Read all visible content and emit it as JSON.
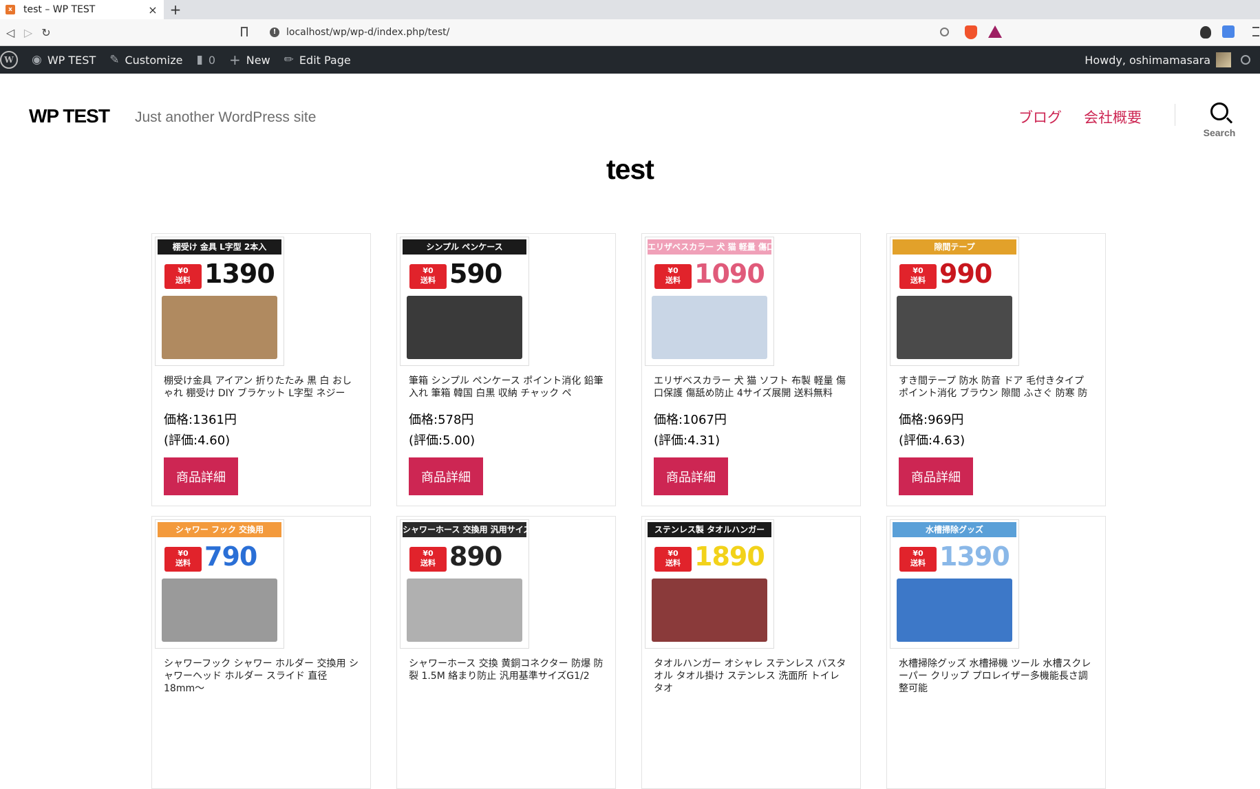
{
  "browser": {
    "tab_title": "test – WP TEST",
    "tab_close": "×",
    "new_tab": "+",
    "url": "localhost/wp/wp-d/index.php/test/"
  },
  "adminbar": {
    "site_name": "WP TEST",
    "customize": "Customize",
    "comments_count": "0",
    "new": "New",
    "edit_page": "Edit Page",
    "howdy": "Howdy, oshimamasara"
  },
  "header": {
    "site_title": "WP TEST",
    "tagline": "Just another WordPress site",
    "nav": [
      "ブログ",
      "会社概要"
    ],
    "search_label": "Search"
  },
  "page": {
    "title": "test"
  },
  "products": [
    {
      "thumb_head": "棚受け 金具 L字型 2本入",
      "thumb_price": "1390",
      "thumb_head_color": "#1a1a1a",
      "thumb_price_color": "#111111",
      "photo_color": "#b08a60",
      "description": "棚受け金具 アイアン 折りたたみ 黒 白 おしゃれ 棚受け DIY ブラケット L字型 ネジー",
      "price": "価格:1361円",
      "rating": "(評価:4.60)",
      "button": "商品詳細"
    },
    {
      "thumb_head": "シンプル ペンケース",
      "thumb_price": "590",
      "thumb_head_color": "#1a1a1a",
      "thumb_price_color": "#111111",
      "photo_color": "#3a3a3a",
      "description": "筆箱 シンプル ペンケース ポイント消化 鉛筆入れ 筆箱 韓国 白黒 収納 チャック ペ",
      "price": "価格:578円",
      "rating": "(評価:5.00)",
      "button": "商品詳細"
    },
    {
      "thumb_head": "エリザベスカラー 犬 猫 軽量 傷口保護",
      "thumb_price": "1090",
      "thumb_head_color": "#f0a0b8",
      "thumb_price_color": "#e05a7a",
      "photo_color": "#c9d6e6",
      "description": "エリザベスカラー 犬 猫 ソフト 布製 軽量 傷口保護 傷舐め防止 4サイズ展開 送料無料",
      "price": "価格:1067円",
      "rating": "(評価:4.31)",
      "button": "商品詳細"
    },
    {
      "thumb_head": "隙間テープ",
      "thumb_price": "990",
      "thumb_head_color": "#e2a12a",
      "thumb_price_color": "#c8161d",
      "photo_color": "#4a4a4a",
      "description": "すき間テープ 防水 防音 ドア 毛付きタイプ ポイント消化 ブラウン 隙間 ふさぐ 防寒 防虫",
      "price": "価格:969円",
      "rating": "(評価:4.63)",
      "button": "商品詳細"
    },
    {
      "thumb_head": "シャワー フック 交換用",
      "thumb_price": "790",
      "thumb_head_color": "#f39a3c",
      "thumb_price_color": "#2a6fd6",
      "photo_color": "#9a9a9a",
      "description": "シャワーフック シャワー ホルダー 交換用 シャワーヘッド ホルダー スライド 直径18mm〜",
      "price": "",
      "rating": "",
      "button": ""
    },
    {
      "thumb_head": "シャワーホース 交換用 汎用サイズ",
      "thumb_price": "890",
      "thumb_head_color": "#2b2b2b",
      "thumb_price_color": "#222222",
      "photo_color": "#b0b0b0",
      "description": "シャワーホース 交換 黄銅コネクター 防爆 防裂 1.5M 絡まり防止 汎用基準サイズG1/2",
      "price": "",
      "rating": "",
      "button": ""
    },
    {
      "thumb_head": "ステンレス製 タオルハンガー",
      "thumb_price": "1890",
      "thumb_head_color": "#1a1a1a",
      "thumb_price_color": "#f2d21a",
      "photo_color": "#8a3a3a",
      "description": "タオルハンガー オシャレ ステンレス バスタオル タオル掛け ステンレス 洗面所 トイレ タオ",
      "price": "",
      "rating": "",
      "button": ""
    },
    {
      "thumb_head": "水槽掃除グッズ",
      "thumb_price": "1390",
      "thumb_head_color": "#5aa0d8",
      "thumb_price_color": "#8ab8e8",
      "photo_color": "#3d78c8",
      "description": "水槽掃除グッズ 水槽掃機 ツール 水槽スクレーパー クリップ プロレイザー多機能長さ調整可能",
      "price": "",
      "rating": "",
      "button": ""
    }
  ]
}
